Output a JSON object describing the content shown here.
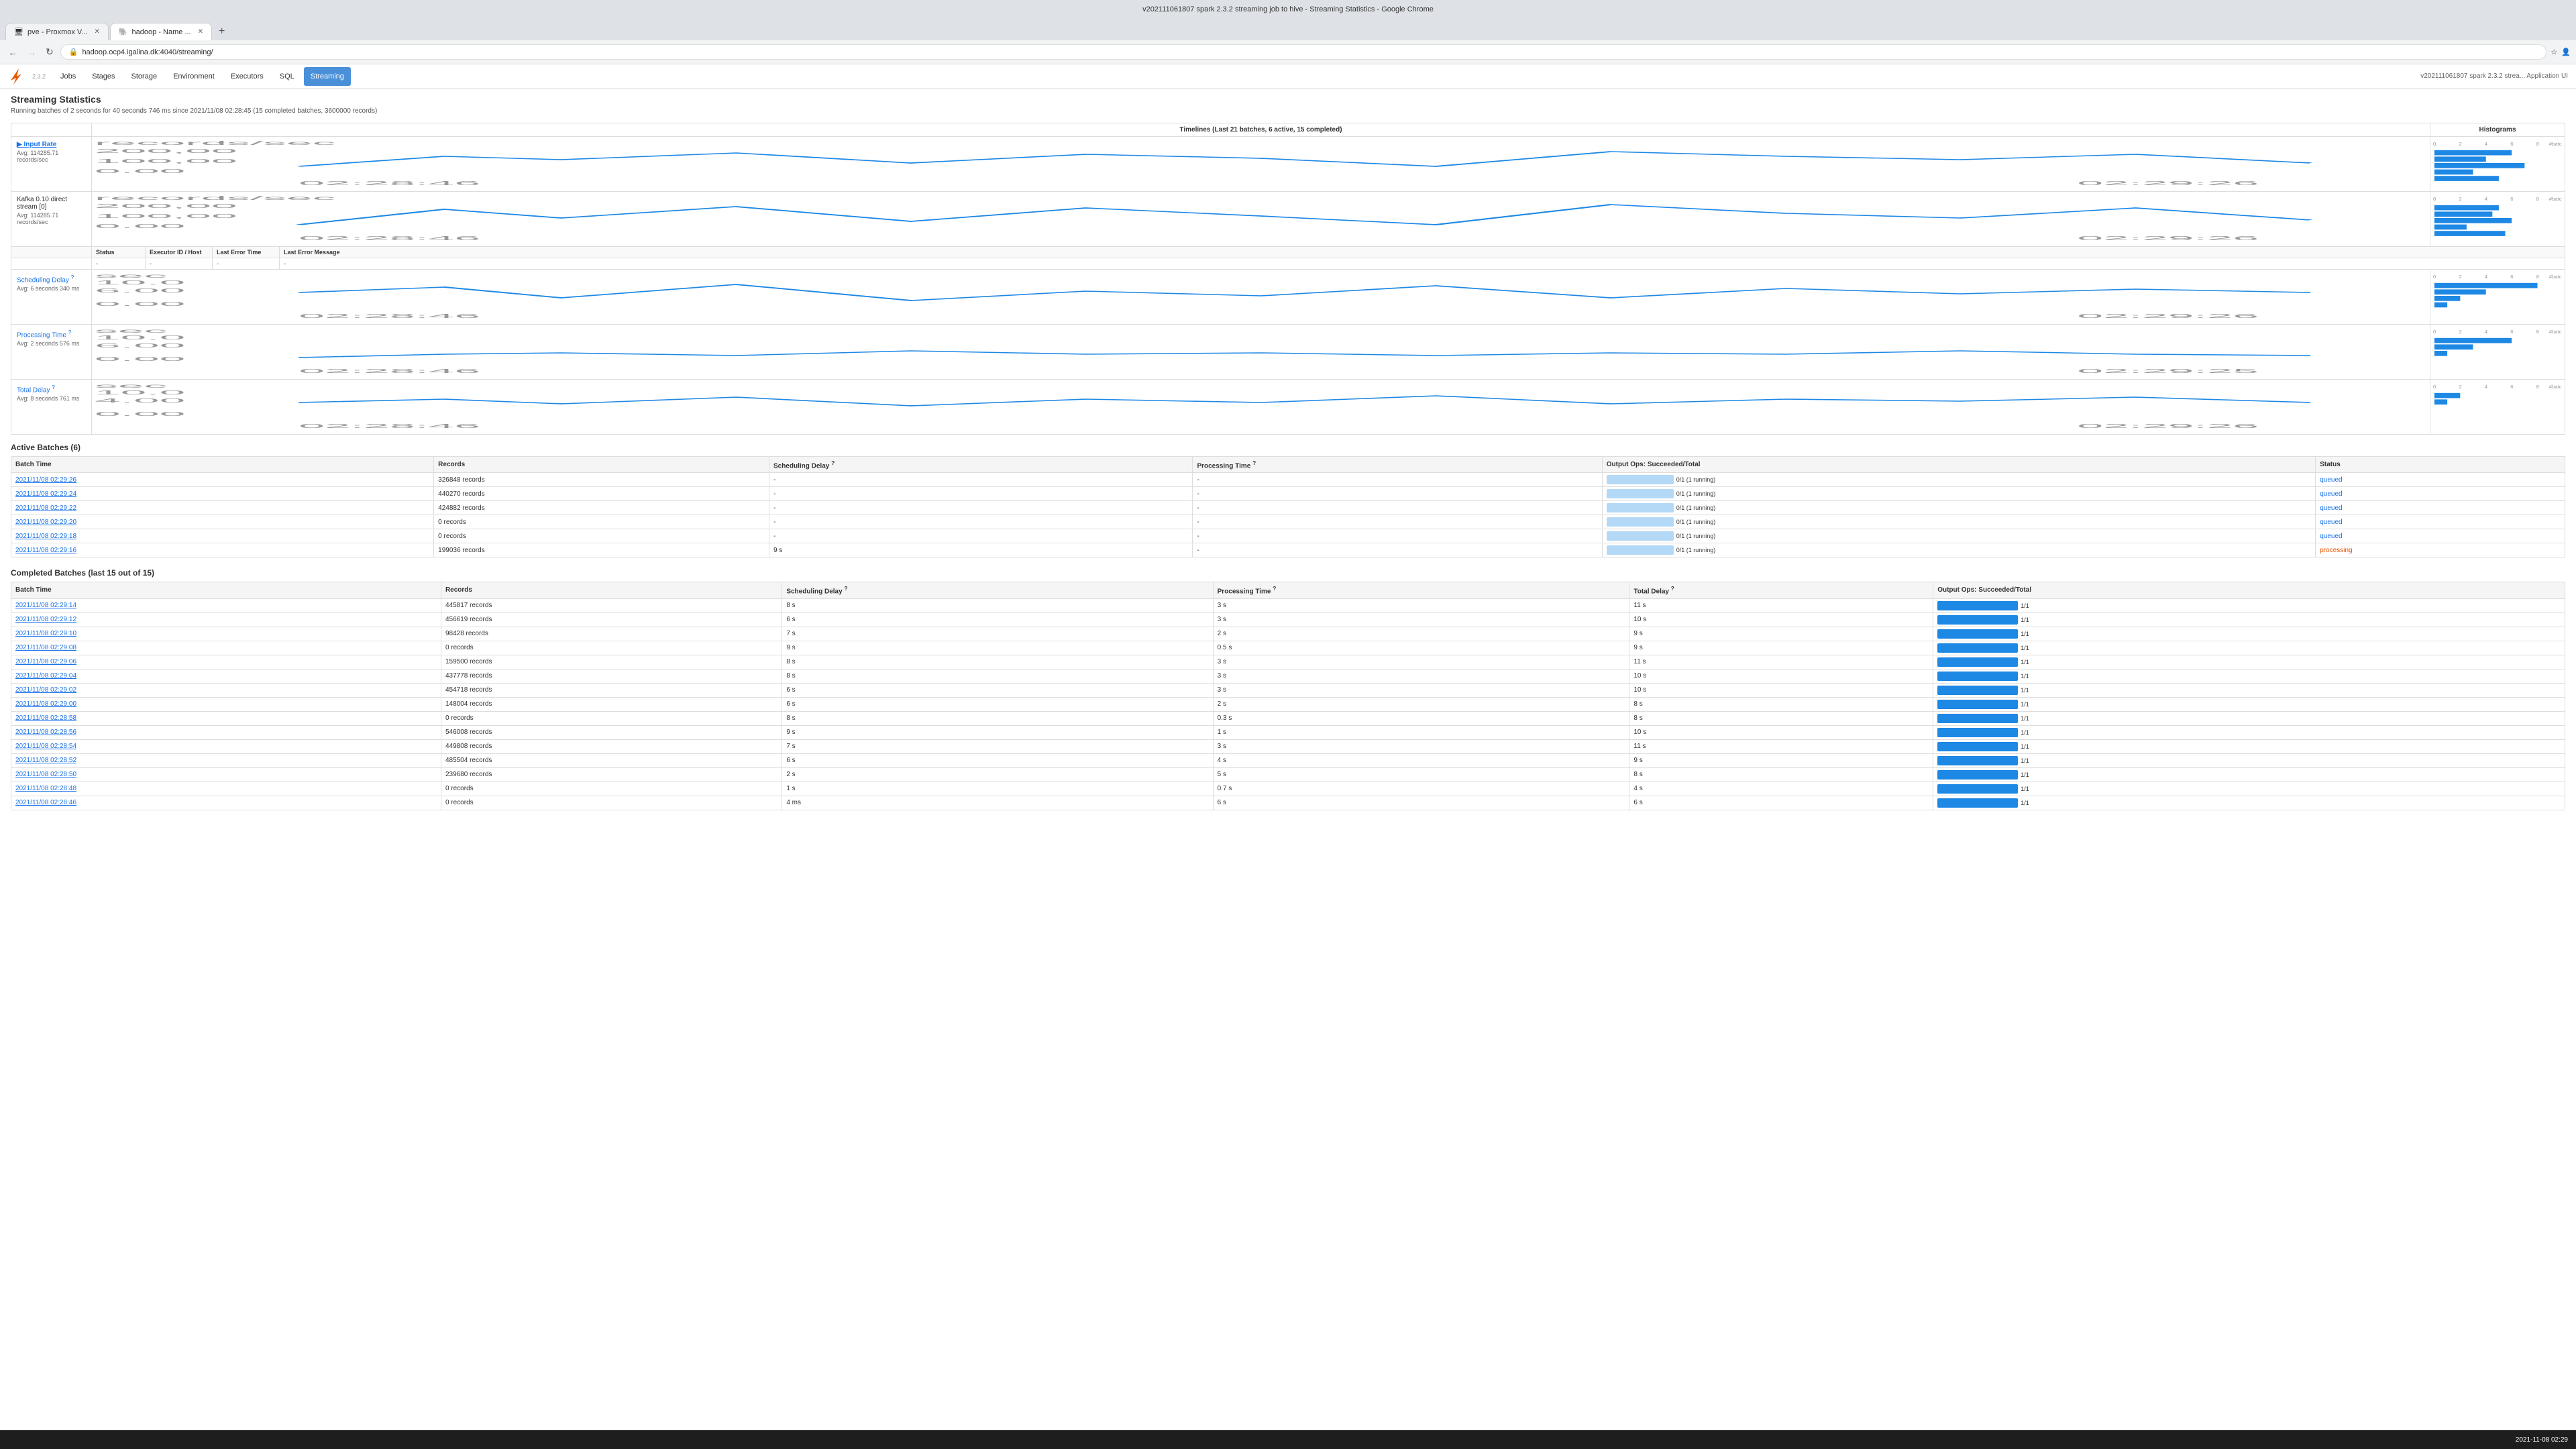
{
  "browser": {
    "title": "v202111061807 spark 2.3.2 streaming job to hive - Streaming Statistics - Google Chrome",
    "tabs": [
      {
        "label": "pve - Proxmox V...",
        "active": false,
        "favicon": "🖥"
      },
      {
        "label": "hadoop - Name ...",
        "active": true,
        "favicon": "🐘"
      }
    ],
    "url": "hadoop.ocp4.igalina.dk:4040/streaming/",
    "lock_icon": "🔒"
  },
  "spark": {
    "logo": "✦",
    "version": "2.3.2",
    "nav": [
      "Jobs",
      "Stages",
      "Storage",
      "Environment",
      "Executors",
      "SQL",
      "Streaming"
    ],
    "active_nav": "Streaming",
    "app_title": "v202111061807 spark 2.3.2 strea... Application UI"
  },
  "page": {
    "title": "Streaming Statistics",
    "subtitle": "Running batches of 2 seconds for 40 seconds 746 ms since 2021/11/08 02:28:45 (15 completed batches, 3600000 records)"
  },
  "chart_headers": {
    "timelines": "Timelines (Last 21 batches, 6 active, 15 completed)",
    "histograms": "Histograms"
  },
  "metrics": [
    {
      "name": "▶ Input Rate",
      "avg": "Avg: 114285.71 records/sec",
      "unit": "records/sec",
      "y_max": "200,00",
      "y_mid": "100,00",
      "y_zero": "0.00",
      "x_left": "02:28:46",
      "x_right": "02:29:26",
      "hist_x_max": "8 #batches",
      "status": null,
      "executor": null,
      "last_err_time": null,
      "last_err_msg": null
    },
    {
      "name": "Kafka 0.10 direct stream [0]",
      "avg": "Avg: 114285.71 records/sec",
      "unit": "records/sec",
      "y_max": "200,00",
      "y_mid": "100,00",
      "y_zero": "0.00",
      "x_left": "02:28:46",
      "x_right": "02:29:26",
      "hist_x_max": "8 #batches",
      "status": "-",
      "executor": "-",
      "last_err_time": "-",
      "last_err_msg": "-"
    },
    {
      "name": "Scheduling Delay",
      "avg": "Avg: 6 seconds 340 ms",
      "unit": "sec",
      "y_max": "10.0",
      "y_mid": "6.00",
      "y_zero": "0.00",
      "x_left": "02:28:46",
      "x_right": "02:29:26",
      "hist_x_max": "8 #batches",
      "status": null,
      "executor": null,
      "last_err_time": null,
      "last_err_msg": null
    },
    {
      "name": "Processing Time",
      "avg": "Avg: 2 seconds 576 ms",
      "unit": "sec",
      "y_max": "10.0",
      "y_mid": "6.00",
      "y_zero": "0.00",
      "x_left": "02:28:46",
      "x_right": "02:29:25",
      "hist_x_max": "8 #batches",
      "status": null,
      "executor": null,
      "last_err_time": null,
      "last_err_msg": null
    },
    {
      "name": "Total Delay",
      "avg": "Avg: 8 seconds 761 ms",
      "unit": "sec",
      "y_max": "10.0",
      "y_mid": "4.00",
      "y_zero": "0.00",
      "x_left": "02:28:46",
      "x_right": "02:29:26",
      "hist_x_max": "8 #batches",
      "status": null,
      "executor": null,
      "last_err_time": null,
      "last_err_msg": null
    }
  ],
  "active_batches": {
    "title": "Active Batches (6)",
    "columns": [
      "Batch Time",
      "Records",
      "Scheduling Delay",
      "Processing Time",
      "Output Ops: Succeeded/Total",
      "Status"
    ],
    "rows": [
      {
        "batch_time": "2021/11/08 02:29:26",
        "records": "326848 records",
        "sched_delay": "-",
        "proc_time": "-",
        "output_ops": "0/1 (1 running)",
        "output_pct": 0,
        "status": "queued"
      },
      {
        "batch_time": "2021/11/08 02:29:24",
        "records": "440270 records",
        "sched_delay": "-",
        "proc_time": "-",
        "output_ops": "0/1 (1 running)",
        "output_pct": 0,
        "status": "queued"
      },
      {
        "batch_time": "2021/11/08 02:29:22",
        "records": "424882 records",
        "sched_delay": "-",
        "proc_time": "-",
        "output_ops": "0/1 (1 running)",
        "output_pct": 0,
        "status": "queued"
      },
      {
        "batch_time": "2021/11/08 02:29:20",
        "records": "0 records",
        "sched_delay": "-",
        "proc_time": "-",
        "output_ops": "0/1 (1 running)",
        "output_pct": 0,
        "status": "queued"
      },
      {
        "batch_time": "2021/11/08 02:29:18",
        "records": "0 records",
        "sched_delay": "-",
        "proc_time": "-",
        "output_ops": "0/1 (1 running)",
        "output_pct": 0,
        "status": "queued"
      },
      {
        "batch_time": "2021/11/08 02:29:16",
        "records": "199036 records",
        "sched_delay": "9 s",
        "proc_time": "-",
        "output_ops": "0/1 (1 running)",
        "output_pct": 0,
        "status": "processing"
      }
    ]
  },
  "completed_batches": {
    "title": "Completed Batches (last 15 out of 15)",
    "columns": [
      "Batch Time",
      "Records",
      "Scheduling Delay",
      "Processing Time",
      "Total Delay",
      "Output Ops: Succeeded/Total"
    ],
    "rows": [
      {
        "batch_time": "2021/11/08 02:29:14",
        "records": "445817 records",
        "sched_delay": "8 s",
        "proc_time": "3 s",
        "total_delay": "11 s",
        "output_ops_pct": 100
      },
      {
        "batch_time": "2021/11/08 02:29:12",
        "records": "456619 records",
        "sched_delay": "6 s",
        "proc_time": "3 s",
        "total_delay": "10 s",
        "output_ops_pct": 100
      },
      {
        "batch_time": "2021/11/08 02:29:10",
        "records": "98428 records",
        "sched_delay": "7 s",
        "proc_time": "2 s",
        "total_delay": "9 s",
        "output_ops_pct": 100
      },
      {
        "batch_time": "2021/11/08 02:29:08",
        "records": "0 records",
        "sched_delay": "9 s",
        "proc_time": "0.5 s",
        "total_delay": "9 s",
        "output_ops_pct": 100
      },
      {
        "batch_time": "2021/11/08 02:29:06",
        "records": "159500 records",
        "sched_delay": "8 s",
        "proc_time": "3 s",
        "total_delay": "11 s",
        "output_ops_pct": 100
      },
      {
        "batch_time": "2021/11/08 02:29:04",
        "records": "437778 records",
        "sched_delay": "8 s",
        "proc_time": "3 s",
        "total_delay": "10 s",
        "output_ops_pct": 100
      },
      {
        "batch_time": "2021/11/08 02:29:02",
        "records": "454718 records",
        "sched_delay": "6 s",
        "proc_time": "3 s",
        "total_delay": "10 s",
        "output_ops_pct": 100
      },
      {
        "batch_time": "2021/11/08 02:29:00",
        "records": "148004 records",
        "sched_delay": "6 s",
        "proc_time": "2 s",
        "total_delay": "8 s",
        "output_ops_pct": 100
      },
      {
        "batch_time": "2021/11/08 02:28:58",
        "records": "0 records",
        "sched_delay": "8 s",
        "proc_time": "0.3 s",
        "total_delay": "8 s",
        "output_ops_pct": 100
      },
      {
        "batch_time": "2021/11/08 02:28:56",
        "records": "546008 records",
        "sched_delay": "9 s",
        "proc_time": "1 s",
        "total_delay": "10 s",
        "output_ops_pct": 100
      },
      {
        "batch_time": "2021/11/08 02:28:54",
        "records": "449808 records",
        "sched_delay": "7 s",
        "proc_time": "3 s",
        "total_delay": "11 s",
        "output_ops_pct": 100
      },
      {
        "batch_time": "2021/11/08 02:28:52",
        "records": "485504 records",
        "sched_delay": "6 s",
        "proc_time": "4 s",
        "total_delay": "9 s",
        "output_ops_pct": 100
      },
      {
        "batch_time": "2021/11/08 02:28:50",
        "records": "239680 records",
        "sched_delay": "2 s",
        "proc_time": "5 s",
        "total_delay": "8 s",
        "output_ops_pct": 100
      },
      {
        "batch_time": "2021/11/08 02:28:48",
        "records": "0 records",
        "sched_delay": "1 s",
        "proc_time": "0.7 s",
        "total_delay": "4 s",
        "output_ops_pct": 100
      },
      {
        "batch_time": "2021/11/08 02:28:46",
        "records": "0 records",
        "sched_delay": "4 ms",
        "proc_time": "6 s",
        "total_delay": "6 s",
        "output_ops_pct": 100
      }
    ]
  },
  "taskbar": {
    "time": "2021-11-08 02:29",
    "date": "2021-11-08"
  }
}
